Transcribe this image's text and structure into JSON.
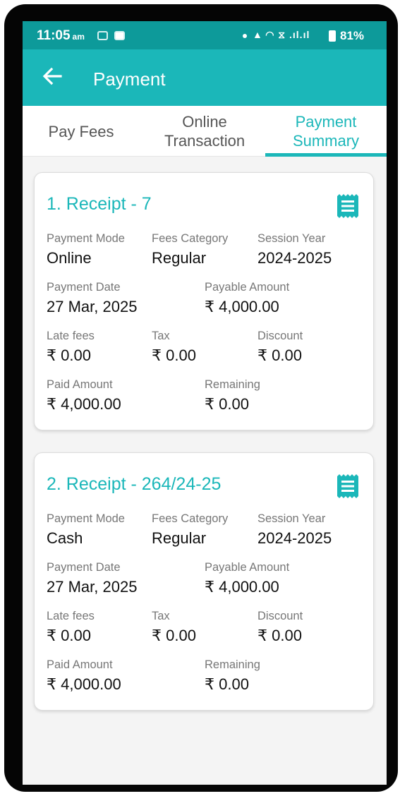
{
  "status_bar": {
    "time": "11:05",
    "ampm": "am",
    "network": "▲ ◠ ⧖ .ıl.ıl",
    "battery": "81%"
  },
  "app_bar": {
    "title": "Payment"
  },
  "tabs": [
    {
      "label": "Pay Fees",
      "active": false
    },
    {
      "label": "Online Transaction",
      "active": false
    },
    {
      "label": "Payment Summary",
      "active": true
    }
  ],
  "labels": {
    "payment_mode": "Payment Mode",
    "fees_category": "Fees Category",
    "session_year": "Session Year",
    "payment_date": "Payment Date",
    "payable_amount": "Payable Amount",
    "late_fees": "Late fees",
    "tax": "Tax",
    "discount": "Discount",
    "paid_amount": "Paid Amount",
    "remaining": "Remaining"
  },
  "receipts": [
    {
      "title": "1. Receipt - 7",
      "payment_mode": "Online",
      "fees_category": "Regular",
      "session_year": "2024-2025",
      "payment_date": "27 Mar, 2025",
      "payable_amount": "₹ 4,000.00",
      "late_fees": "₹ 0.00",
      "tax": "₹ 0.00",
      "discount": "₹ 0.00",
      "paid_amount": "₹ 4,000.00",
      "remaining": "₹ 0.00"
    },
    {
      "title": "2. Receipt - 264/24-25",
      "payment_mode": "Cash",
      "fees_category": "Regular",
      "session_year": "2024-2025",
      "payment_date": "27 Mar, 2025",
      "payable_amount": "₹ 4,000.00",
      "late_fees": "₹ 0.00",
      "tax": "₹ 0.00",
      "discount": "₹ 0.00",
      "paid_amount": "₹ 4,000.00",
      "remaining": "₹ 0.00"
    }
  ],
  "colors": {
    "accent": "#1bb7b9",
    "status_bar": "#0d9a9a"
  }
}
